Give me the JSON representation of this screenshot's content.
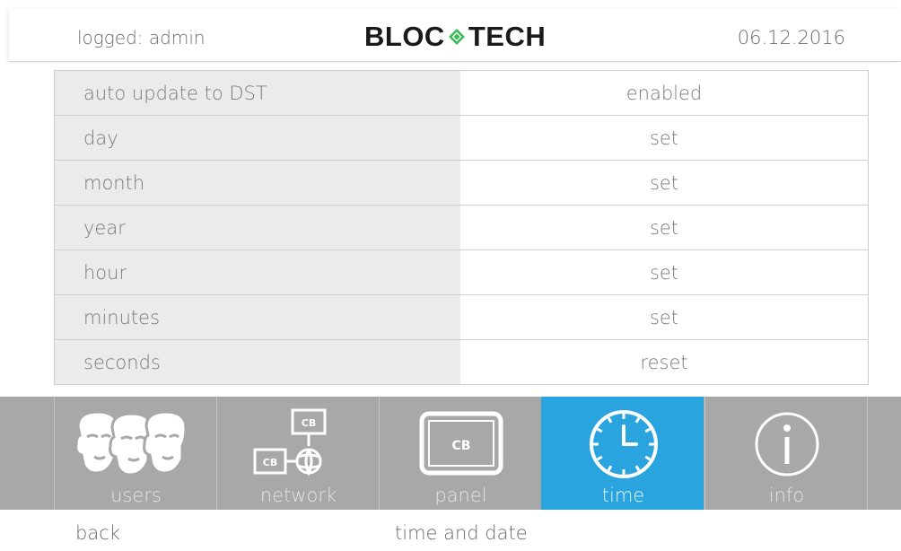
{
  "header": {
    "user": "logged: admin",
    "logo_left": "BLOC",
    "logo_right": "TECH",
    "date": "06.12.2016"
  },
  "settings": [
    {
      "label": "auto update to DST",
      "value": "enabled"
    },
    {
      "label": "day",
      "value": "set"
    },
    {
      "label": "month",
      "value": "set"
    },
    {
      "label": "year",
      "value": "set"
    },
    {
      "label": "hour",
      "value": "set"
    },
    {
      "label": "minutes",
      "value": "set"
    },
    {
      "label": "seconds",
      "value": "reset"
    }
  ],
  "nav": [
    {
      "label": "users",
      "icon": "faces-icon"
    },
    {
      "label": "network",
      "icon": "network-icon",
      "badge": "CB"
    },
    {
      "label": "panel",
      "icon": "panel-icon",
      "badge": "CB"
    },
    {
      "label": "time",
      "icon": "clock-icon",
      "active": true
    },
    {
      "label": "info",
      "icon": "info-icon"
    }
  ],
  "footer": {
    "back": "back",
    "title": "time and date"
  },
  "colors": {
    "accent": "#2aa4de",
    "nav_bg": "#a8a8a8",
    "label_bg": "#ebebeb",
    "logo_green": "#3dbb5a"
  }
}
